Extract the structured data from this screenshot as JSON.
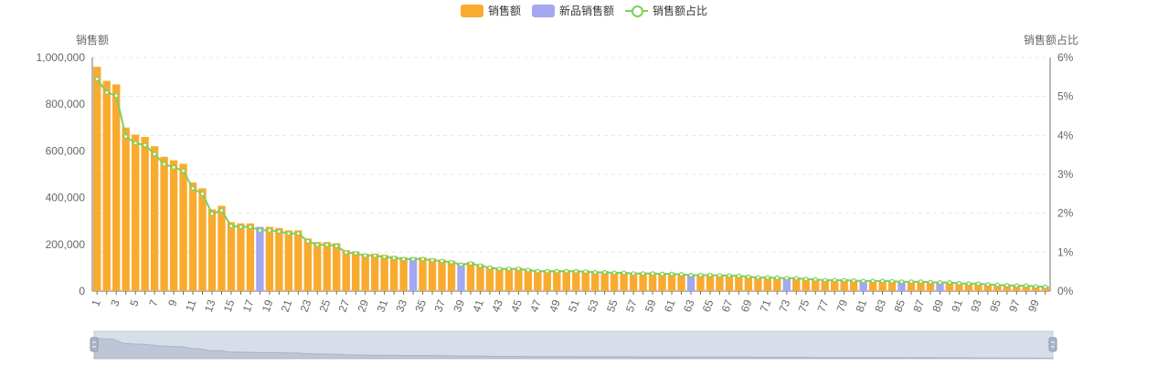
{
  "legend": {
    "sales": "销售额",
    "new_sales": "新品销售额",
    "ratio": "销售额占比"
  },
  "axes": {
    "left_name": "销售额",
    "right_name": "销售额占比"
  },
  "colors": {
    "sales": "#f9ab2f",
    "new_sales": "#a3a8f0",
    "ratio": "#7ed05b",
    "grid": "#e6e6e6",
    "axis": "#666666",
    "slider_bg": "#d8dee9"
  },
  "chart_data": {
    "type": "bar",
    "categories": [
      "1",
      "2",
      "3",
      "4",
      "5",
      "6",
      "7",
      "8",
      "9",
      "10",
      "11",
      "12",
      "13",
      "14",
      "15",
      "16",
      "17",
      "18",
      "19",
      "20",
      "21",
      "22",
      "23",
      "24",
      "25",
      "26",
      "27",
      "28",
      "29",
      "30",
      "31",
      "32",
      "33",
      "34",
      "35",
      "36",
      "37",
      "38",
      "39",
      "40",
      "41",
      "42",
      "43",
      "44",
      "45",
      "46",
      "47",
      "48",
      "49",
      "50",
      "51",
      "52",
      "53",
      "54",
      "55",
      "56",
      "57",
      "58",
      "59",
      "60",
      "61",
      "62",
      "63",
      "64",
      "65",
      "66",
      "67",
      "68",
      "69",
      "70",
      "71",
      "72",
      "73",
      "74",
      "75",
      "76",
      "77",
      "78",
      "79",
      "80",
      "81",
      "82",
      "83",
      "84",
      "85",
      "86",
      "87",
      "88",
      "89",
      "90",
      "91",
      "92",
      "93",
      "94",
      "95",
      "96",
      "97",
      "98",
      "99",
      "100"
    ],
    "series": [
      {
        "name": "销售额",
        "type": "bar",
        "values": [
          960000,
          900000,
          885000,
          700000,
          670000,
          660000,
          620000,
          575000,
          560000,
          545000,
          465000,
          440000,
          350000,
          365000,
          295000,
          290000,
          290000,
          0,
          275000,
          270000,
          260000,
          260000,
          225000,
          210000,
          210000,
          205000,
          175000,
          170000,
          160000,
          160000,
          155000,
          150000,
          145000,
          0,
          145000,
          140000,
          135000,
          130000,
          0,
          125000,
          115000,
          105000,
          100000,
          100000,
          100000,
          95000,
          90000,
          90000,
          90000,
          90000,
          90000,
          88000,
          85000,
          85000,
          82000,
          82000,
          80000,
          80000,
          80000,
          78000,
          78000,
          75000,
          0,
          72000,
          72000,
          70000,
          70000,
          68000,
          65000,
          62000,
          62000,
          60000,
          0,
          58000,
          55000,
          52000,
          50000,
          50000,
          50000,
          48000,
          0,
          45000,
          45000,
          44000,
          0,
          43000,
          42000,
          40000,
          0,
          38000,
          36000,
          34000,
          33000,
          30000,
          28000,
          26000,
          25000,
          24000,
          22000,
          20000
        ]
      },
      {
        "name": "新品销售额",
        "type": "bar",
        "values": [
          0,
          0,
          0,
          0,
          0,
          0,
          0,
          0,
          0,
          0,
          0,
          0,
          0,
          0,
          0,
          0,
          0,
          275000,
          0,
          0,
          0,
          0,
          0,
          0,
          0,
          0,
          0,
          0,
          0,
          0,
          0,
          0,
          0,
          145000,
          0,
          0,
          0,
          0,
          120000,
          0,
          0,
          0,
          0,
          0,
          0,
          0,
          0,
          0,
          0,
          0,
          0,
          0,
          0,
          0,
          0,
          0,
          0,
          0,
          0,
          0,
          0,
          0,
          72000,
          0,
          0,
          0,
          0,
          0,
          0,
          0,
          0,
          0,
          58000,
          0,
          0,
          0,
          0,
          0,
          0,
          0,
          46000,
          0,
          0,
          0,
          43000,
          0,
          0,
          0,
          38000,
          0,
          0,
          0,
          0,
          0,
          0,
          0,
          0,
          0,
          0,
          0
        ]
      },
      {
        "name": "销售额占比",
        "type": "line",
        "unit": "%",
        "values": [
          5.45,
          5.1,
          5.02,
          3.97,
          3.8,
          3.75,
          3.52,
          3.26,
          3.18,
          3.09,
          2.64,
          2.5,
          1.99,
          2.07,
          1.67,
          1.65,
          1.65,
          1.56,
          1.56,
          1.53,
          1.48,
          1.48,
          1.28,
          1.19,
          1.19,
          1.16,
          0.99,
          0.97,
          0.91,
          0.91,
          0.88,
          0.85,
          0.82,
          0.82,
          0.82,
          0.79,
          0.77,
          0.74,
          0.68,
          0.71,
          0.65,
          0.6,
          0.57,
          0.57,
          0.57,
          0.54,
          0.51,
          0.51,
          0.51,
          0.51,
          0.51,
          0.5,
          0.48,
          0.48,
          0.47,
          0.47,
          0.45,
          0.45,
          0.45,
          0.44,
          0.44,
          0.43,
          0.41,
          0.41,
          0.41,
          0.4,
          0.4,
          0.39,
          0.37,
          0.35,
          0.35,
          0.34,
          0.33,
          0.33,
          0.31,
          0.3,
          0.28,
          0.28,
          0.28,
          0.27,
          0.26,
          0.26,
          0.26,
          0.25,
          0.24,
          0.24,
          0.24,
          0.23,
          0.22,
          0.22,
          0.2,
          0.19,
          0.19,
          0.17,
          0.16,
          0.15,
          0.14,
          0.14,
          0.12,
          0.11
        ]
      }
    ],
    "y_left": {
      "min": 0,
      "max": 1000000,
      "ticks": [
        "0",
        "200,000",
        "400,000",
        "600,000",
        "800,000",
        "1,000,000"
      ]
    },
    "y_right": {
      "min": 0,
      "max": 6,
      "ticks": [
        "0%",
        "1%",
        "2%",
        "3%",
        "4%",
        "5%",
        "6%"
      ]
    },
    "grid": true,
    "legend_position": "top-center",
    "datazoom": {
      "start": 0,
      "end": 100
    }
  }
}
